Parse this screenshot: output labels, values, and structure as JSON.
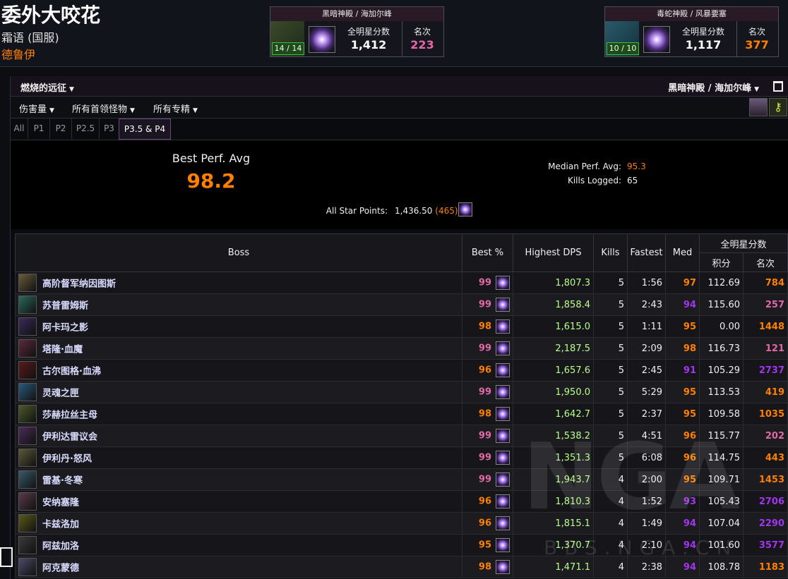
{
  "character": {
    "name": "委外大咬花",
    "server": "霜语 (国服)",
    "class": "德鲁伊"
  },
  "zone_cards": [
    {
      "title": "黑暗神殿 / 海加尔峰",
      "progress": "14 / 14",
      "label1": "全明星分数",
      "value1": "1,412",
      "label2": "名次",
      "value2": "223",
      "rank_color": "#e268a8"
    },
    {
      "title": "毒蛇神殿 / 风暴要塞",
      "progress": "10 / 10",
      "label1": "全明星分数",
      "value1": "1,117",
      "label2": "名次",
      "value2": "377",
      "rank_color": "#ff8000"
    }
  ],
  "toolbar": {
    "expansion": "燃烧的远征",
    "zone": "黑暗神殿 / 海加尔峰"
  },
  "filters": [
    "伤害量",
    "所有首领怪物",
    "所有专精"
  ],
  "phase_tabs": [
    "All",
    "P1",
    "P2",
    "P2.5",
    "P3",
    "P3.5 & P4"
  ],
  "active_tab": "P3.5 & P4",
  "summary": {
    "best_label": "Best Perf. Avg",
    "best_value": "98.2",
    "median_label": "Median Perf. Avg:",
    "median_value": "95.3",
    "kills_label": "Kills Logged:",
    "kills_value": "65",
    "allstar_label": "All Star Points:",
    "allstar_value": "1,436.50",
    "allstar_rank": "(465)"
  },
  "table": {
    "headers": {
      "boss": "Boss",
      "best": "Best %",
      "dps": "Highest DPS",
      "kills": "Kills",
      "fastest": "Fastest",
      "med": "Med",
      "allstar": "全明星分数",
      "score": "积分",
      "rank": "名次"
    },
    "rows": [
      {
        "boss": "高阶督军纳因图斯",
        "best": "99",
        "best_color": "#e268a8",
        "dps": "1,807.3",
        "kills": "5",
        "fastest": "1:56",
        "med": "97",
        "med_color": "#ff8000",
        "score": "112.69",
        "rank": "784",
        "rank_color": "#ff8000",
        "icon_color": "#6a5a3a"
      },
      {
        "boss": "苏普雷姆斯",
        "best": "99",
        "best_color": "#e268a8",
        "dps": "1,858.4",
        "kills": "5",
        "fastest": "2:43",
        "med": "94",
        "med_color": "#a335ee",
        "score": "115.60",
        "rank": "257",
        "rank_color": "#e268a8",
        "icon_color": "#2a6a5a"
      },
      {
        "boss": "阿卡玛之影",
        "best": "98",
        "best_color": "#ff8000",
        "dps": "1,615.0",
        "kills": "5",
        "fastest": "1:11",
        "med": "95",
        "med_color": "#ff8000",
        "score": "0.00",
        "rank": "1448",
        "rank_color": "#ff8000",
        "icon_color": "#3a2a5a"
      },
      {
        "boss": "塔隆·血魔",
        "best": "99",
        "best_color": "#e268a8",
        "dps": "2,187.5",
        "kills": "5",
        "fastest": "2:09",
        "med": "98",
        "med_color": "#ff8000",
        "score": "116.73",
        "rank": "121",
        "rank_color": "#e268a8",
        "icon_color": "#5a2a3a"
      },
      {
        "boss": "古尔图格·血沸",
        "best": "96",
        "best_color": "#ff8000",
        "dps": "1,657.6",
        "kills": "5",
        "fastest": "2:45",
        "med": "91",
        "med_color": "#a335ee",
        "score": "105.29",
        "rank": "2737",
        "rank_color": "#a335ee",
        "icon_color": "#5a1a1a"
      },
      {
        "boss": "灵魂之匣",
        "best": "99",
        "best_color": "#e268a8",
        "dps": "1,950.0",
        "kills": "5",
        "fastest": "5:29",
        "med": "95",
        "med_color": "#ff8000",
        "score": "113.53",
        "rank": "419",
        "rank_color": "#ff8000",
        "icon_color": "#2a5a7a"
      },
      {
        "boss": "莎赫拉丝主母",
        "best": "98",
        "best_color": "#ff8000",
        "dps": "1,642.7",
        "kills": "5",
        "fastest": "2:37",
        "med": "95",
        "med_color": "#ff8000",
        "score": "109.58",
        "rank": "1035",
        "rank_color": "#ff8000",
        "icon_color": "#4a5a2a"
      },
      {
        "boss": "伊利达雷议会",
        "best": "99",
        "best_color": "#e268a8",
        "dps": "1,538.2",
        "kills": "5",
        "fastest": "4:51",
        "med": "96",
        "med_color": "#ff8000",
        "score": "115.77",
        "rank": "202",
        "rank_color": "#e268a8",
        "icon_color": "#4a2a5a"
      },
      {
        "boss": "伊利丹·怒风",
        "best": "99",
        "best_color": "#e268a8",
        "dps": "1,351.3",
        "kills": "5",
        "fastest": "6:08",
        "med": "96",
        "med_color": "#ff8000",
        "score": "114.75",
        "rank": "443",
        "rank_color": "#ff8000",
        "icon_color": "#5a5a3a"
      },
      {
        "boss": "雷基·冬寒",
        "best": "99",
        "best_color": "#e268a8",
        "dps": "1,943.7",
        "kills": "4",
        "fastest": "2:00",
        "med": "95",
        "med_color": "#ff8000",
        "score": "109.71",
        "rank": "1453",
        "rank_color": "#ff8000",
        "icon_color": "#3a5a6a"
      },
      {
        "boss": "安纳塞隆",
        "best": "96",
        "best_color": "#ff8000",
        "dps": "1,810.3",
        "kills": "4",
        "fastest": "1:52",
        "med": "93",
        "med_color": "#a335ee",
        "score": "105.43",
        "rank": "2706",
        "rank_color": "#a335ee",
        "icon_color": "#5a3a4a"
      },
      {
        "boss": "卡兹洛加",
        "best": "96",
        "best_color": "#ff8000",
        "dps": "1,815.1",
        "kills": "4",
        "fastest": "1:49",
        "med": "94",
        "med_color": "#a335ee",
        "score": "107.04",
        "rank": "2290",
        "rank_color": "#a335ee",
        "icon_color": "#5a5a1a"
      },
      {
        "boss": "阿兹加洛",
        "best": "95",
        "best_color": "#ff8000",
        "dps": "1,370.7",
        "kills": "4",
        "fastest": "2:10",
        "med": "94",
        "med_color": "#a335ee",
        "score": "101.60",
        "rank": "3577",
        "rank_color": "#a335ee",
        "icon_color": "#3a3a3a"
      },
      {
        "boss": "阿克蒙德",
        "best": "98",
        "best_color": "#ff8000",
        "dps": "1,471.1",
        "kills": "4",
        "fastest": "2:38",
        "med": "94",
        "med_color": "#a335ee",
        "score": "108.78",
        "rank": "1183",
        "rank_color": "#ff8000",
        "icon_color": "#4a4a6a"
      }
    ]
  },
  "watermark": {
    "logo": "NGA",
    "url": "BBS.NGA.CN"
  }
}
